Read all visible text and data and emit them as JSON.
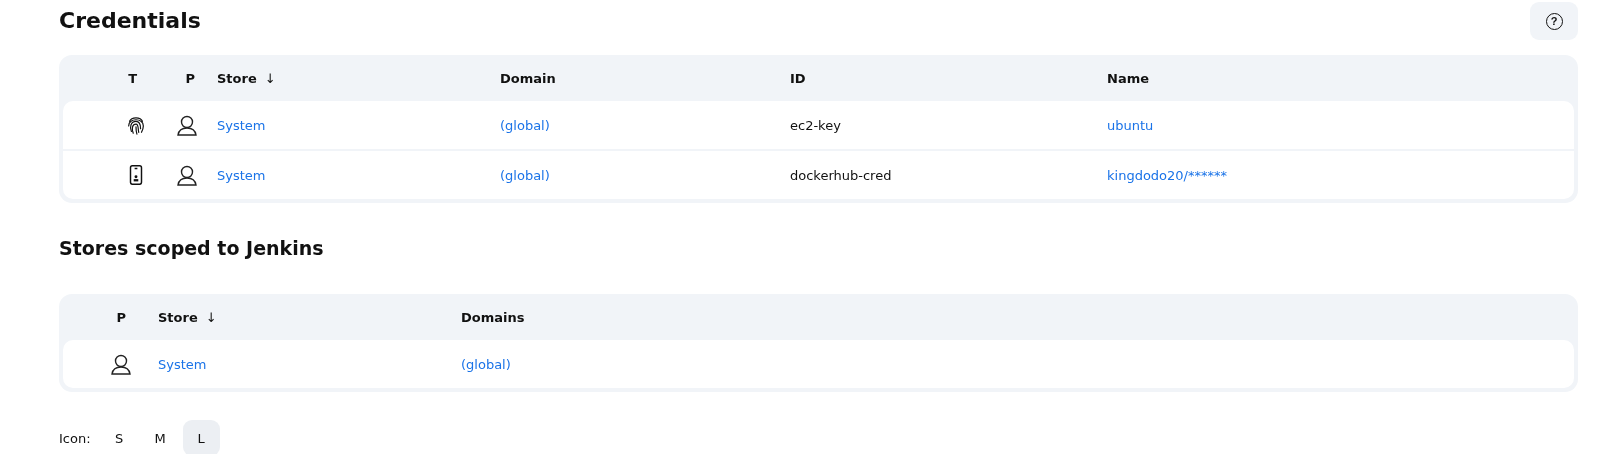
{
  "credentials": {
    "title": "Credentials",
    "help_button": "?",
    "columns": [
      "T",
      "P",
      "Store",
      "Domain",
      "ID",
      "Name"
    ],
    "sort_indicator": "↓",
    "rows": [
      {
        "kind": "fingerprint",
        "store": "System",
        "domain": "(global)",
        "id": "ec2-key",
        "name": "ubuntu"
      },
      {
        "kind": "phone",
        "store": "System",
        "domain": "(global)",
        "id": "dockerhub-cred",
        "name": "kingdodo20/******"
      }
    ]
  },
  "stores": {
    "title": "Stores scoped to Jenkins",
    "columns": [
      "P",
      "Store",
      "Domains"
    ],
    "sort_indicator": "↓",
    "rows": [
      {
        "store": "System",
        "domains": "(global)"
      }
    ]
  },
  "icon_size": {
    "label": "Icon:",
    "options": [
      {
        "label": "S",
        "selected": false
      },
      {
        "label": "M",
        "selected": false
      },
      {
        "label": "L",
        "selected": true
      }
    ]
  }
}
